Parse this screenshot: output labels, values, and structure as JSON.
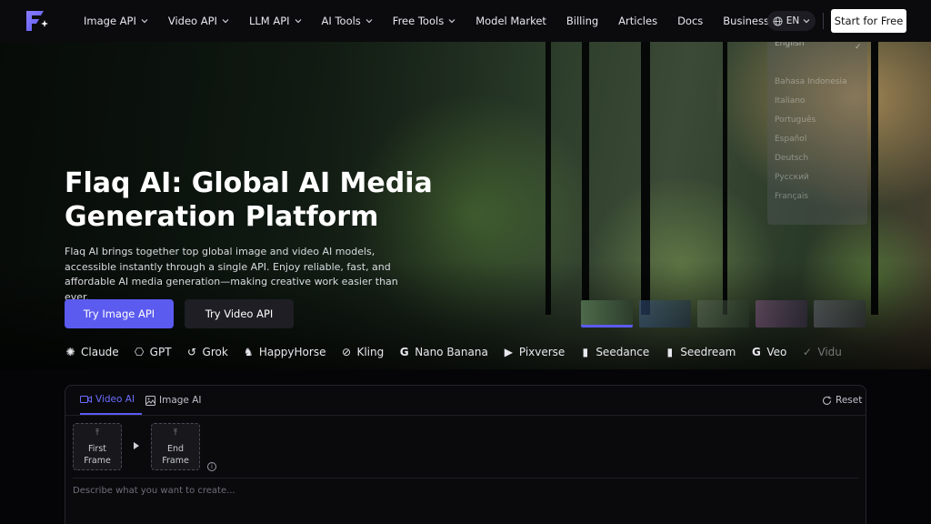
{
  "header": {
    "nav": [
      {
        "label": "Image API",
        "dropdown": true
      },
      {
        "label": "Video API",
        "dropdown": true
      },
      {
        "label": "LLM API",
        "dropdown": true
      },
      {
        "label": "AI Tools",
        "dropdown": true
      },
      {
        "label": "Free Tools",
        "dropdown": true
      },
      {
        "label": "Model Market",
        "dropdown": false
      },
      {
        "label": "Billing",
        "dropdown": false
      },
      {
        "label": "Articles",
        "dropdown": false
      },
      {
        "label": "Docs",
        "dropdown": false
      },
      {
        "label": "Business",
        "dropdown": false
      }
    ],
    "language": "EN",
    "cta": "Start for Free"
  },
  "language_menu": {
    "selected": "English",
    "options": [
      "English",
      "Bahasa Indonesia",
      "Italiano",
      "Português",
      "Español",
      "Deutsch",
      "Русский",
      "Français"
    ]
  },
  "hero": {
    "title": "Flaq AI: Global AI Media Generation Platform",
    "description": "Flaq AI brings together top global image and video AI models, accessible instantly through a single API. Enjoy reliable, fast, and affordable AI media generation—making creative work easier than ever.",
    "primary_button": "Try Image API",
    "secondary_button": "Try Video API",
    "models": [
      {
        "name": "Claude",
        "icon": "claude-icon"
      },
      {
        "name": "GPT",
        "icon": "openai-icon"
      },
      {
        "name": "Grok",
        "icon": "grok-icon"
      },
      {
        "name": "HappyHorse",
        "icon": "horse-icon"
      },
      {
        "name": "Kling",
        "icon": "kling-icon"
      },
      {
        "name": "Nano Banana",
        "icon": "google-icon"
      },
      {
        "name": "Pixverse",
        "icon": "pixverse-icon"
      },
      {
        "name": "Seedance",
        "icon": "bars-icon"
      },
      {
        "name": "Seedream",
        "icon": "bars-icon"
      },
      {
        "name": "Veo",
        "icon": "google-icon"
      },
      {
        "name": "Vidu",
        "icon": "vidu-icon"
      }
    ]
  },
  "generator": {
    "tabs": {
      "video": "Video AI",
      "image": "Image AI"
    },
    "reset": "Reset",
    "first_frame": "First Frame",
    "end_frame": "End Frame",
    "prompt_placeholder": "Describe what you want to create..."
  },
  "colors": {
    "accent": "#5b5bf0",
    "background": "#050507"
  }
}
